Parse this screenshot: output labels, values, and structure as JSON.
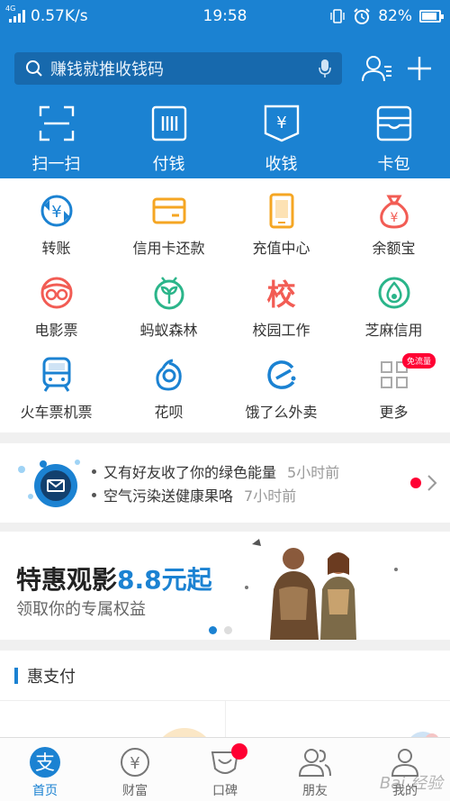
{
  "status_bar": {
    "network": "4G",
    "speed": "0.57K/s",
    "time": "19:58",
    "battery": "82%"
  },
  "header": {
    "search_placeholder": "赚钱就推收钱码",
    "actions": [
      {
        "name": "contacts",
        "icon": "contacts-icon"
      },
      {
        "name": "add",
        "icon": "plus-icon"
      }
    ],
    "quick_actions": [
      {
        "label": "扫一扫",
        "icon": "scan-icon"
      },
      {
        "label": "付钱",
        "icon": "pay-barcode-icon"
      },
      {
        "label": "收钱",
        "icon": "receive-money-icon"
      },
      {
        "label": "卡包",
        "icon": "card-wallet-icon"
      }
    ]
  },
  "grid": {
    "items": [
      {
        "label": "转账",
        "icon": "transfer-icon",
        "color": "#1b82d2"
      },
      {
        "label": "信用卡还款",
        "icon": "credit-card-icon",
        "color": "#f5a623"
      },
      {
        "label": "充值中心",
        "icon": "phone-recharge-icon",
        "color": "#f5a623"
      },
      {
        "label": "余额宝",
        "icon": "money-bag-icon",
        "color": "#f25c54"
      },
      {
        "label": "电影票",
        "icon": "movie-glasses-icon",
        "color": "#f25c54"
      },
      {
        "label": "蚂蚁森林",
        "icon": "ant-forest-icon",
        "color": "#2bb58a"
      },
      {
        "label": "校园工作",
        "icon": "campus-icon",
        "color": "#f25c54",
        "glyph": "校"
      },
      {
        "label": "芝麻信用",
        "icon": "sesame-credit-icon",
        "color": "#2bb58a"
      },
      {
        "label": "火车票机票",
        "icon": "train-icon",
        "color": "#1b82d2"
      },
      {
        "label": "花呗",
        "icon": "huabei-icon",
        "color": "#1b82d2"
      },
      {
        "label": "饿了么外卖",
        "icon": "eleme-icon",
        "color": "#1b82d2"
      },
      {
        "label": "更多",
        "icon": "more-grid-icon",
        "color": "#aaaaaa",
        "tag": "免流量"
      }
    ]
  },
  "notice": {
    "messages": [
      {
        "text": "又有好友收了你的绿色能量",
        "time": "5小时前"
      },
      {
        "text": "空气污染送健康果咯",
        "time": "7小时前"
      }
    ]
  },
  "banner": {
    "title_prefix": "特惠观影",
    "title_highlight": "8.8元起",
    "subtitle": "领取你的专属权益",
    "page_count": 2,
    "active_page": 1
  },
  "section": {
    "title": "惠支付"
  },
  "tabbar": {
    "tabs": [
      {
        "label": "首页",
        "icon": "home-alipay-icon",
        "active": true
      },
      {
        "label": "财富",
        "icon": "wealth-icon",
        "active": false
      },
      {
        "label": "口碑",
        "icon": "koubei-icon",
        "active": false,
        "badge": true
      },
      {
        "label": "朋友",
        "icon": "friends-icon",
        "active": false
      },
      {
        "label": "我的",
        "icon": "me-icon",
        "active": false
      }
    ]
  },
  "watermark": "Bai 经验",
  "colors": {
    "primary": "#1b82d2",
    "accent_red": "#f03",
    "orange": "#f5a623",
    "green": "#2bb58a"
  }
}
